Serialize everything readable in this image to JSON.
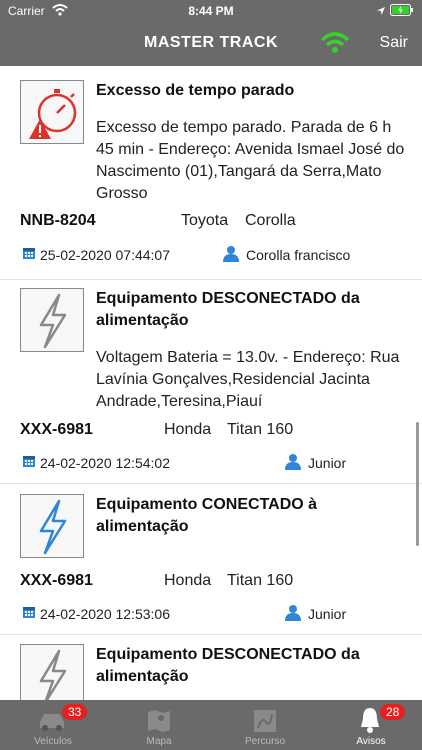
{
  "status": {
    "carrier": "Carrier",
    "time": "8:44 PM"
  },
  "nav": {
    "title": "MASTER TRACK",
    "logout": "Sair"
  },
  "items": [
    {
      "title": "Excesso de tempo parado",
      "desc": "Excesso de tempo parado. Parada de 6 h 45 min  - Endereço: Avenida Ismael José do Nascimento (01),Tangará da Serra,Mato Grosso",
      "plate": "NNB-8204",
      "brand": "Toyota",
      "model": "Corolla",
      "datetime": "25-02-2020 07:44:07",
      "driver": "Corolla francisco",
      "icon": "stopwatch-alert-icon"
    },
    {
      "title": "Equipamento DESCONECTADO da alimentação",
      "desc": "Voltagem Bateria = 13.0v. - Endereço: Rua Lavínia Gonçalves,Residencial Jacinta Andrade,Teresina,Piauí",
      "plate": "XXX-6981",
      "brand": "Honda",
      "model": "Titan 160",
      "datetime": "24-02-2020 12:54:02",
      "driver": "Junior",
      "icon": "lightning-gray-icon"
    },
    {
      "title": "Equipamento CONECTADO à alimentação",
      "desc": "",
      "plate": "XXX-6981",
      "brand": "Honda",
      "model": "Titan 160",
      "datetime": "24-02-2020 12:53:06",
      "driver": "Junior",
      "icon": "lightning-blue-icon"
    },
    {
      "title": "Equipamento DESCONECTADO da alimentação",
      "desc": "",
      "plate": "",
      "brand": "",
      "model": "",
      "datetime": "",
      "driver": "",
      "icon": "lightning-gray-icon"
    }
  ],
  "tabs": [
    {
      "label": "Veículos",
      "badge": "33"
    },
    {
      "label": "Mapa",
      "badge": ""
    },
    {
      "label": "Percurso",
      "badge": ""
    },
    {
      "label": "Avisos",
      "badge": "28"
    }
  ],
  "colors": {
    "bars": "#6a6a6a",
    "accent_red": "#d9342b",
    "accent_blue": "#2e87d6",
    "badge": "#e52020",
    "wifi_green": "#35d12e"
  }
}
